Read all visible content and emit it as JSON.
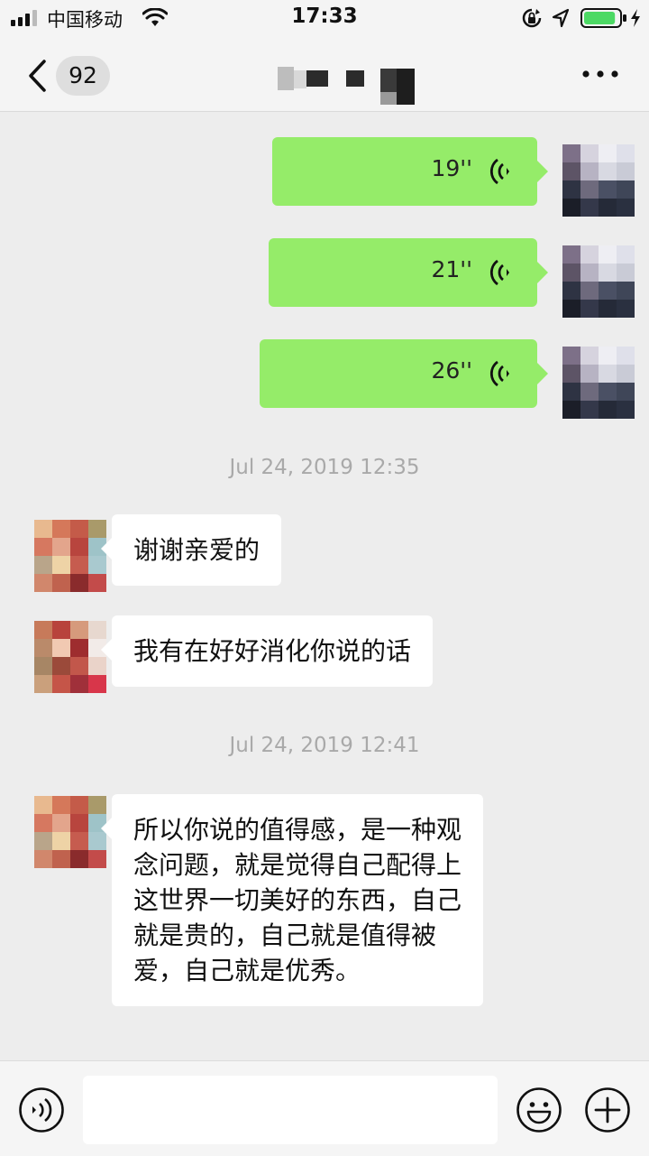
{
  "status_bar": {
    "carrier": "中国移动",
    "time": "17:33",
    "battery_level": 0.9
  },
  "nav": {
    "unread_count": "92",
    "more_icon": "more-horizontal-icon"
  },
  "messages": [
    {
      "type": "voice",
      "side": "right",
      "duration": "19''"
    },
    {
      "type": "voice",
      "side": "right",
      "duration": "21''"
    },
    {
      "type": "voice",
      "side": "right",
      "duration": "26''"
    },
    {
      "type": "timestamp",
      "text": "Jul 24, 2019 12:35"
    },
    {
      "type": "text",
      "side": "left",
      "lines": [
        "谢谢亲爱的"
      ]
    },
    {
      "type": "text",
      "side": "left",
      "lines": [
        "我有在好好消化你说的话"
      ]
    },
    {
      "type": "timestamp",
      "text": "Jul 24, 2019 12:41"
    },
    {
      "type": "text",
      "side": "left",
      "lines": [
        "所以你说的值得感，是一种观",
        "念问题，就是觉得自己配得上",
        "这世界一切美好的东西，自己",
        "就是贵的，自己就是值得被",
        "爱，自己就是优秀。"
      ]
    }
  ],
  "input_bar": {
    "value": "",
    "icons": [
      "voice-input-icon",
      "emoji-icon",
      "plus-icon"
    ]
  },
  "colors": {
    "outgoing_bubble": "#95ec69",
    "incoming_bubble": "#ffffff",
    "background": "#ededed",
    "battery": "#4cd964"
  }
}
